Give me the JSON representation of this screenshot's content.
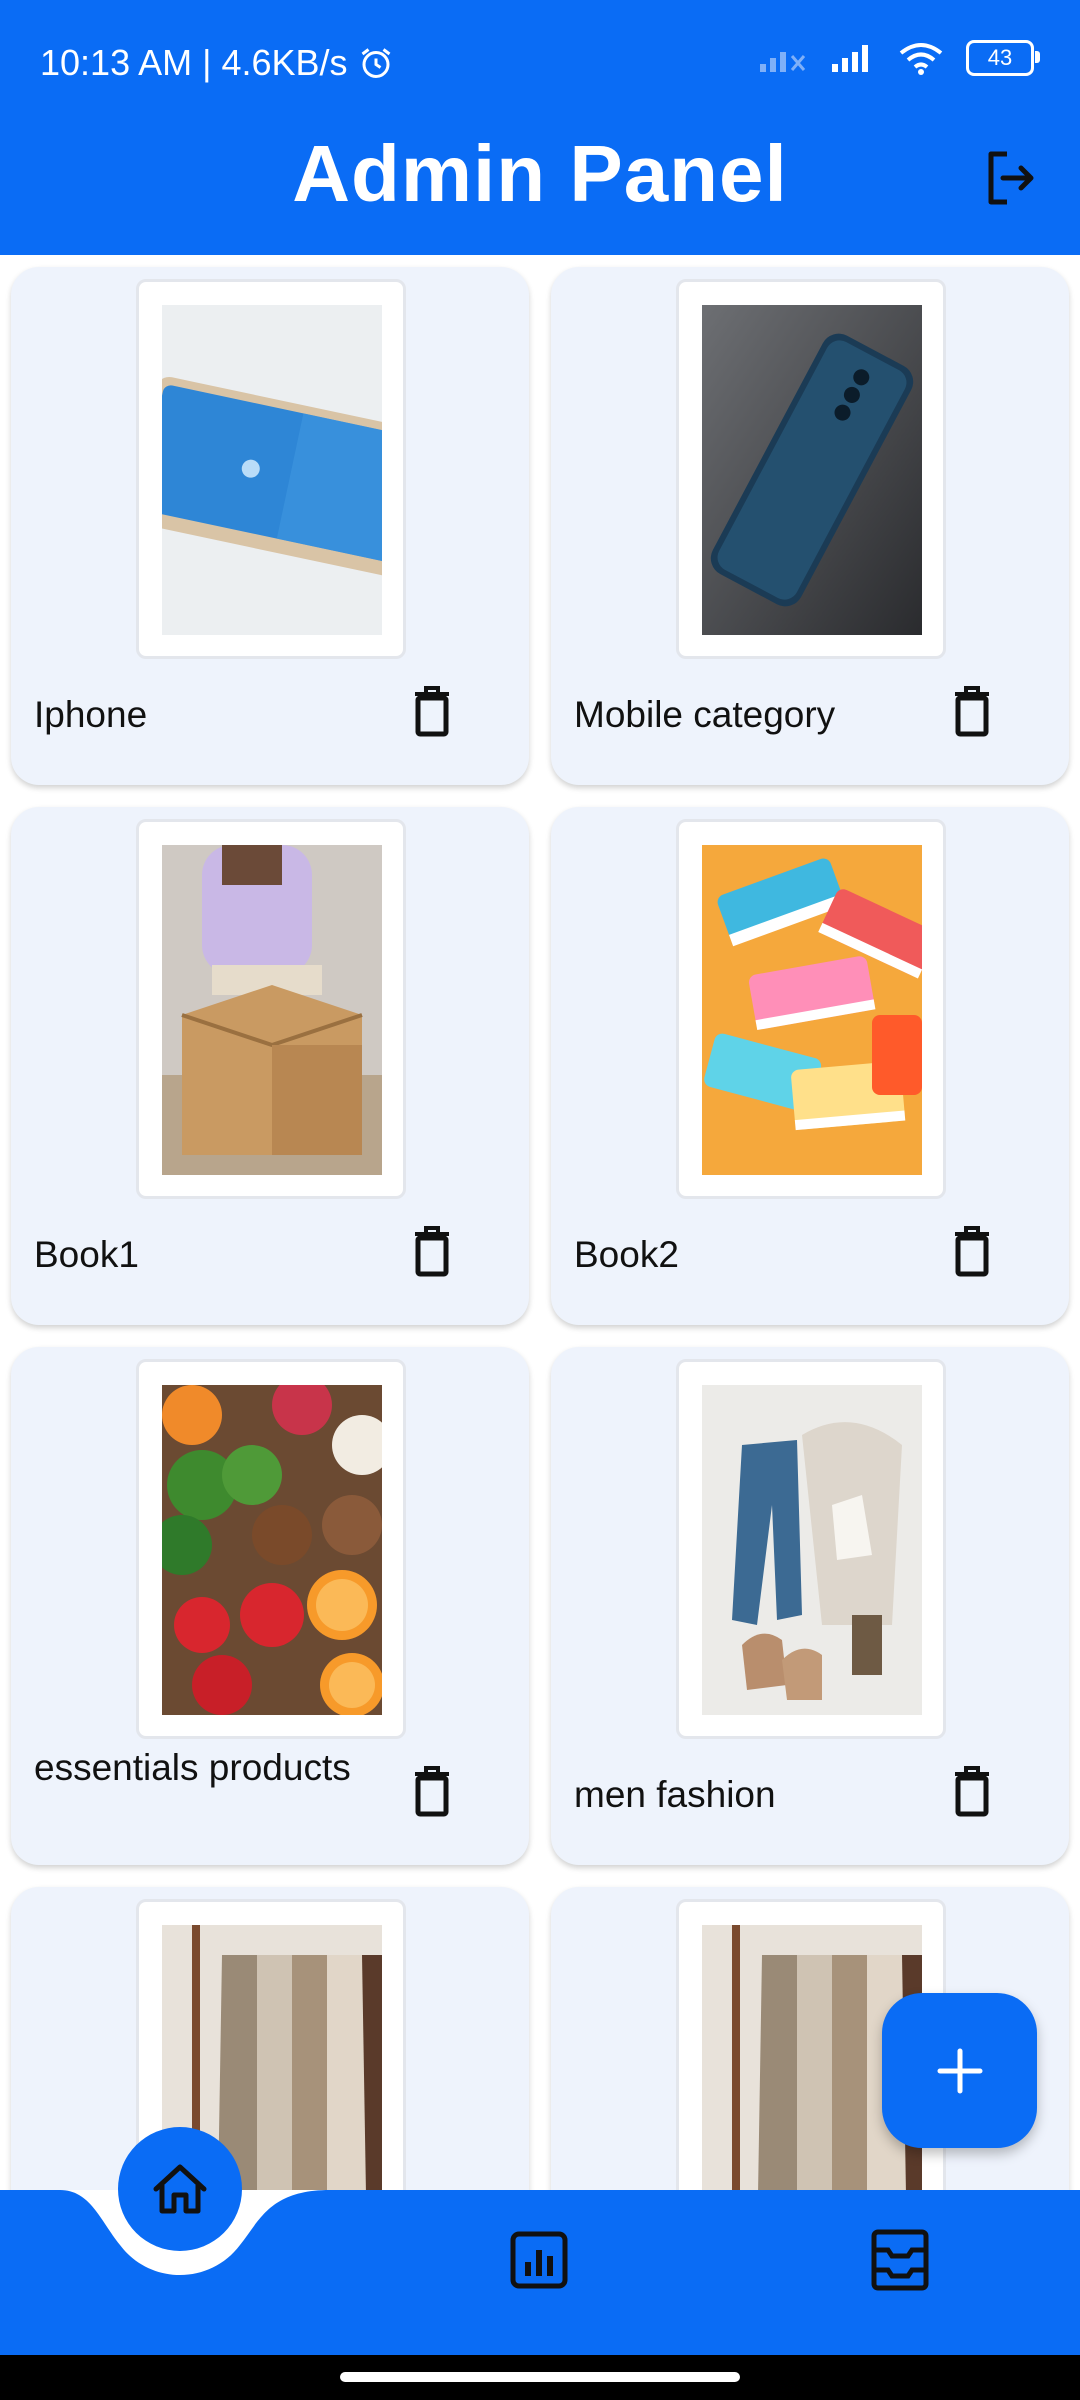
{
  "status_bar": {
    "time_speed": "10:13 AM | 4.6KB/s",
    "battery": "43"
  },
  "app_bar": {
    "title": "Admin Panel"
  },
  "categories": [
    {
      "label": "Iphone",
      "image": "tablet-photo"
    },
    {
      "label": "Mobile category",
      "image": "smartphone-photo"
    },
    {
      "label": "Book1",
      "image": "book-box-photo"
    },
    {
      "label": "Book2",
      "image": "colorful-books-photo"
    },
    {
      "label": "essentials products",
      "image": "fresh-produce-photo"
    },
    {
      "label": "men fashion",
      "image": "clothes-flatlay-photo"
    },
    {
      "label": "",
      "image": "clothes-rack-photo"
    },
    {
      "label": "",
      "image": "clothes-rack-photo"
    }
  ],
  "colors": {
    "primary": "#0a6cf5",
    "card_bg": "#eef3fc"
  },
  "icons": {
    "logout": "logout-icon",
    "delete": "trash-icon",
    "add": "plus-icon",
    "nav_home": "home-icon",
    "nav_stats": "chart-icon",
    "nav_orders": "inbox-icon"
  }
}
